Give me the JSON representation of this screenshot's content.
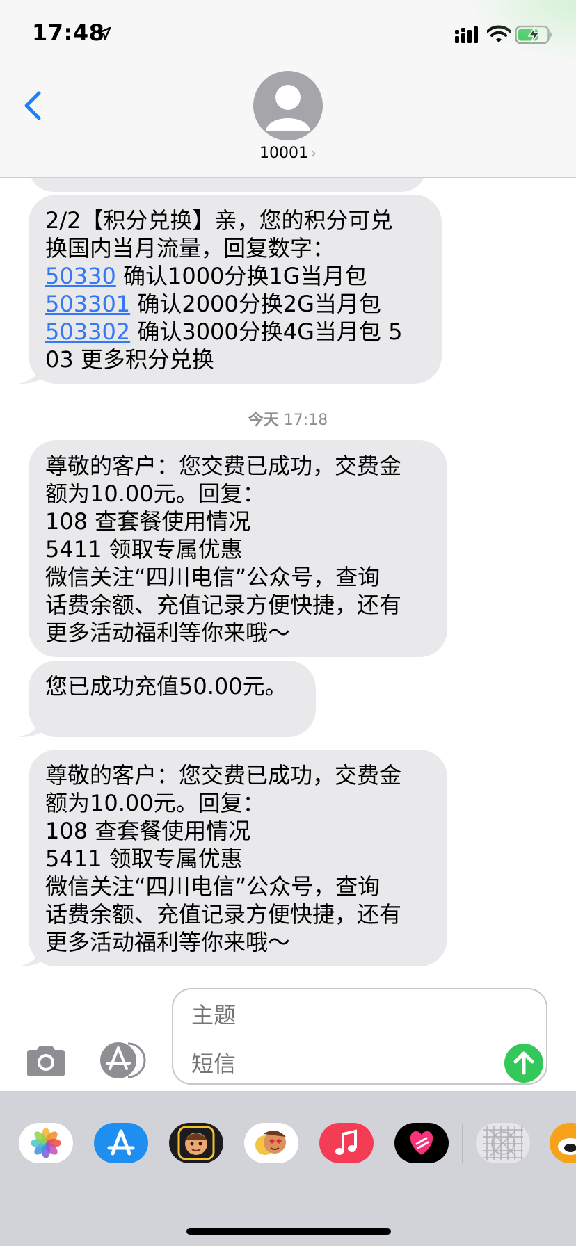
{
  "status_bar": {
    "time": "17:48"
  },
  "header": {
    "contact": "10001",
    "chevron": "›"
  },
  "messages": [
    {
      "lines": [
        [
          {
            "text": "2/2【积分兑换】亲，您的积分可兑"
          }
        ],
        [
          {
            "text": "换国内当月流量，回复数字："
          }
        ],
        [
          {
            "text": "50330",
            "link": true
          },
          {
            "text": " 确认1000分换1G当月包"
          }
        ],
        [
          {
            "text": "503301",
            "link": true
          },
          {
            "text": " 确认2000分换2G当月包"
          }
        ],
        [
          {
            "text": "503302",
            "link": true
          },
          {
            "text": " 确认3000分换4G当月包 5"
          }
        ],
        [
          {
            "text": "03 更多积分兑换"
          }
        ]
      ]
    },
    {
      "lines": [
        [
          {
            "text": "尊敬的客户：您交费已成功，交费金"
          }
        ],
        [
          {
            "text": "额为10.00元。回复："
          }
        ],
        [
          {
            "text": "108 查套餐使用情况"
          }
        ],
        [
          {
            "text": "5411 领取专属优惠"
          }
        ],
        [
          {
            "text": "微信关注“四川电信”公众号，查询"
          }
        ],
        [
          {
            "text": "话费余额、充值记录方便快捷，还有"
          }
        ],
        [
          {
            "text": "更多活动福利等你来哦～"
          }
        ]
      ]
    },
    {
      "lines": [
        [
          {
            "text": "您已成功充值50.00元。"
          }
        ]
      ]
    },
    {
      "lines": [
        [
          {
            "text": "尊敬的客户：您交费已成功，交费金"
          }
        ],
        [
          {
            "text": "额为10.00元。回复："
          }
        ],
        [
          {
            "text": "108 查套餐使用情况"
          }
        ],
        [
          {
            "text": "5411 领取专属优惠"
          }
        ],
        [
          {
            "text": "微信关注“四川电信”公众号，查询"
          }
        ],
        [
          {
            "text": "话费余额、充值记录方便快捷，还有"
          }
        ],
        [
          {
            "text": "更多活动福利等你来哦～"
          }
        ]
      ]
    }
  ],
  "timestamp": {
    "day": "今天",
    "time": "17:18"
  },
  "compose": {
    "subject_placeholder": "主题",
    "message_placeholder": "短信"
  },
  "app_drawer": {
    "apps": [
      "photos-icon",
      "app-store-icon",
      "memoji-icon",
      "animoji-icon",
      "music-icon",
      "digital-touch-icon",
      "sticker-grid-icon",
      "weibo-icon"
    ]
  },
  "colors": {
    "bubble": "#e9e9eb",
    "link": "#3478f6",
    "send": "#34c759",
    "back": "#1a82fb"
  }
}
